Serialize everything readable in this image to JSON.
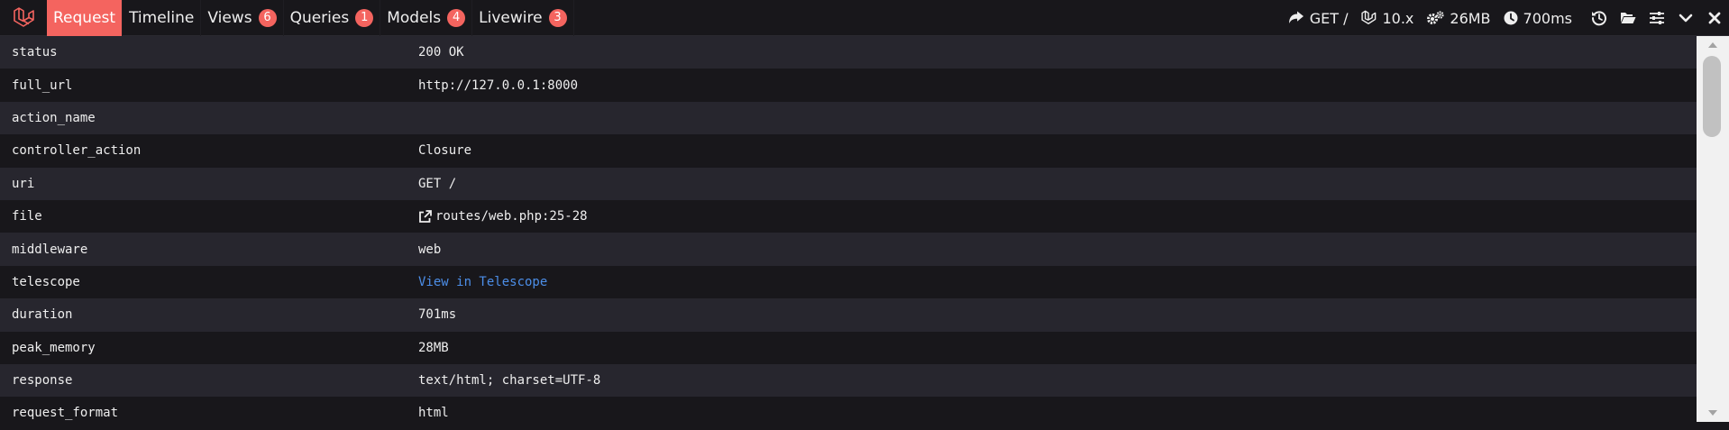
{
  "tabs": [
    {
      "label": "Request",
      "active": true
    },
    {
      "label": "Timeline"
    },
    {
      "label": "Views",
      "badge": "6"
    },
    {
      "label": "Queries",
      "badge": "1"
    },
    {
      "label": "Models",
      "badge": "4"
    },
    {
      "label": "Livewire",
      "badge": "3"
    }
  ],
  "stats": {
    "route": "GET /",
    "version": "10.x",
    "memory": "26MB",
    "time": "700ms"
  },
  "rows": [
    {
      "key": "status",
      "value": "200 OK"
    },
    {
      "key": "full_url",
      "value": "http://127.0.0.1:8000"
    },
    {
      "key": "action_name",
      "value": ""
    },
    {
      "key": "controller_action",
      "value": "Closure"
    },
    {
      "key": "uri",
      "value": "GET /"
    },
    {
      "key": "file",
      "value": "routes/web.php:25-28"
    },
    {
      "key": "middleware",
      "value": "web"
    },
    {
      "key": "telescope",
      "value": "View in Telescope"
    },
    {
      "key": "duration",
      "value": "701ms"
    },
    {
      "key": "peak_memory",
      "value": "28MB"
    },
    {
      "key": "response",
      "value": "text/html; charset=UTF-8"
    },
    {
      "key": "request_format",
      "value": "html"
    }
  ],
  "colors": {
    "accent": "#f4645f",
    "link": "#4c8ee8",
    "row_alt": "#27262e",
    "background": "#18171b"
  },
  "icons": [
    "laravel-logo",
    "share-arrow-icon",
    "laravel-version-icon",
    "gears-icon",
    "clock-icon",
    "history-icon",
    "folder-open-icon",
    "sliders-icon",
    "chevron-down-icon",
    "close-icon",
    "external-link-icon"
  ]
}
